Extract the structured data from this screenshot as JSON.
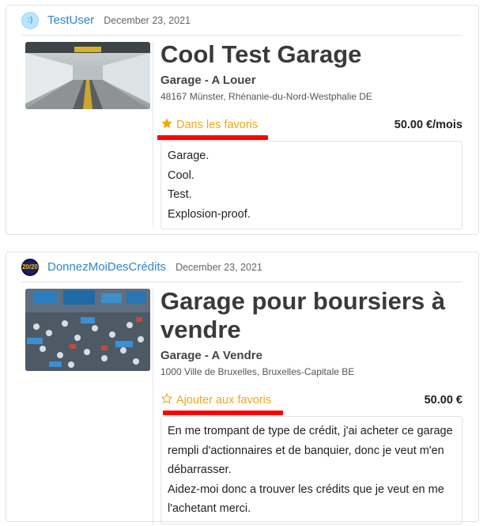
{
  "listings": [
    {
      "username": "TestUser",
      "avatar_text": ":)",
      "date": "December 23, 2021",
      "title": "Cool Test Garage",
      "subtitle": "Garage - A Louer",
      "address": "48167 Münster, Rhénanie-du-Nord-Westphalie DE",
      "favorite_label": "Dans les favoris",
      "favorite_icon": "star-filled-icon",
      "is_favorite": true,
      "price": "50.00 €/mois",
      "description": [
        "Garage.",
        "Cool.",
        "Test.",
        "Explosion-proof."
      ]
    },
    {
      "username": "DonnezMoiDesCrédits",
      "avatar_text": "20/20",
      "date": "December 23, 2021",
      "title": "Garage pour boursiers à vendre",
      "subtitle": "Garage - A Vendre",
      "address": "1000 Ville de Bruxelles, Bruxelles-Capitale BE",
      "favorite_label": "Ajouter aux favoris",
      "favorite_icon": "star-outline-icon",
      "is_favorite": false,
      "price": "50.00 €",
      "description": [
        "En me trompant de type de crédit, j'ai acheter ce garage rempli d'actionnaires et de banquier, donc je veut m'en débarrasser.",
        "Aidez-moi donc a trouver les crédits que je veut en me l'achetant merci."
      ]
    }
  ],
  "colors": {
    "link": "#2f86d1",
    "favorite": "#f0a818",
    "highlight": "#ff0000"
  }
}
